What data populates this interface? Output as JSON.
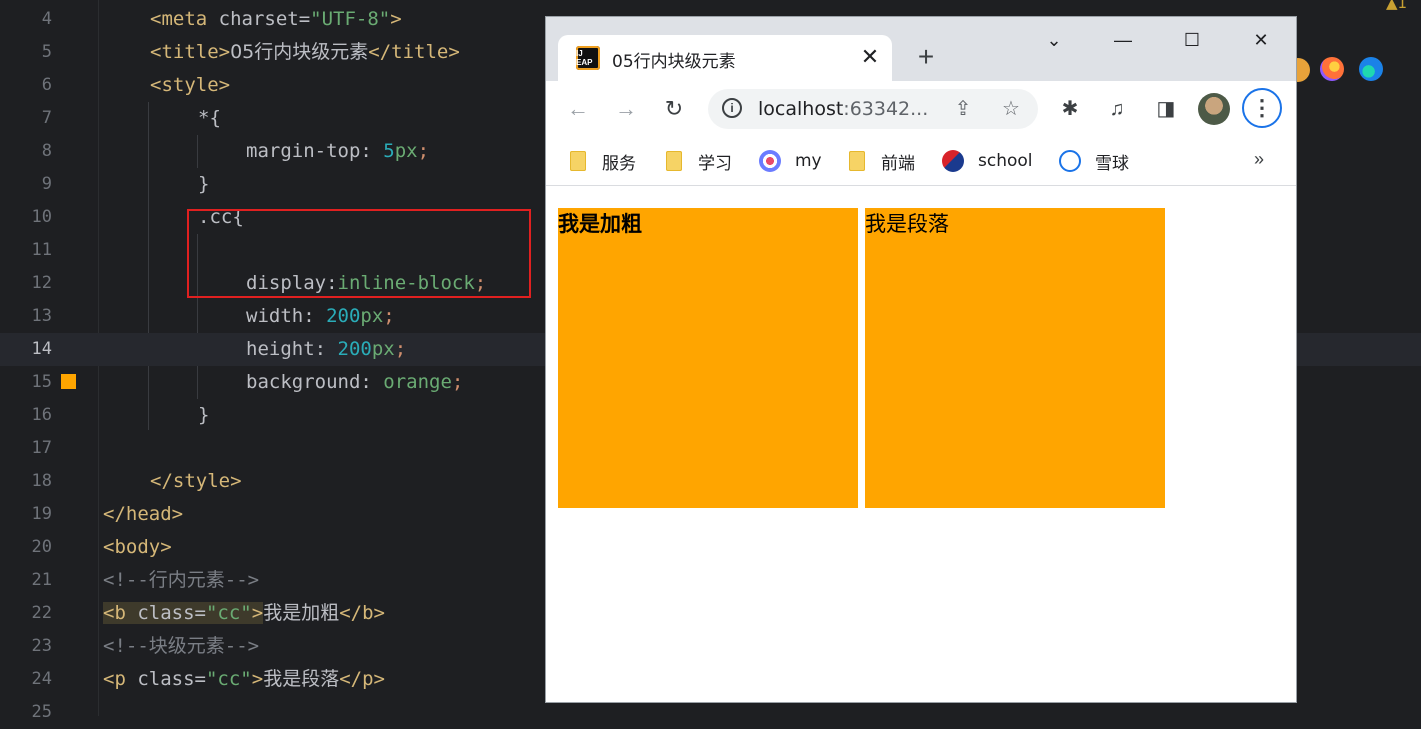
{
  "editor": {
    "lines": [
      {
        "n": "4"
      },
      {
        "n": "5"
      },
      {
        "n": "6"
      },
      {
        "n": "7"
      },
      {
        "n": "8"
      },
      {
        "n": "9"
      },
      {
        "n": "10"
      },
      {
        "n": "11"
      },
      {
        "n": "12"
      },
      {
        "n": "13"
      },
      {
        "n": "14"
      },
      {
        "n": "15"
      },
      {
        "n": "16"
      },
      {
        "n": "17"
      },
      {
        "n": "18"
      },
      {
        "n": "19"
      },
      {
        "n": "20"
      },
      {
        "n": "21"
      },
      {
        "n": "22"
      },
      {
        "n": "23"
      },
      {
        "n": "24"
      },
      {
        "n": "25"
      }
    ],
    "code": {
      "l4_tag_open": "<meta",
      "l4_attr": " charset=",
      "l4_str": "\"UTF-8\"",
      "l4_close": ">",
      "l5_open": "<title>",
      "l5_text_num": "05",
      "l5_text": "行内块级元素",
      "l5_close": "</title>",
      "l6": "<style>",
      "l7": "*{",
      "l8_prop": "margin-top: ",
      "l8_num": "5",
      "l8_unit": "px",
      "l8_semi": ";",
      "l9": "}",
      "l10": ".cc{",
      "l12_prop": "display:",
      "l12_val": "inline-block",
      "l12_semi": ";",
      "l13_prop": "width: ",
      "l13_num": "200",
      "l13_unit": "px",
      "l13_semi": ";",
      "l14_prop": "height: ",
      "l14_num": "200",
      "l14_unit": "px",
      "l14_semi": ";",
      "l15_prop": "background: ",
      "l15_val": "orange",
      "l15_semi": ";",
      "l16": "}",
      "l18": "</style>",
      "l19": "</head>",
      "l20": "<body>",
      "l21_a": "<!--",
      "l21_txt": "行内元素",
      "l21_b": "-->",
      "l22_open": "<b",
      "l22_attr": " class=",
      "l22_str": "\"cc\"",
      "l22_gt": ">",
      "l22_txt": "我是加粗",
      "l22_close": "</b>",
      "l23_a": "<!--",
      "l23_txt": "块级元素",
      "l23_b": "-->",
      "l24_open": "<p",
      "l24_attr": " class=",
      "l24_str": "\"cc\"",
      "l24_gt": ">",
      "l24_txt": "我是段落",
      "l24_close": "</p>"
    },
    "warning_count": "1",
    "current_line": "14"
  },
  "browser": {
    "tab": {
      "title": "05行内块级元素",
      "favicon_text": "IJ EAP"
    },
    "toolbar": {
      "url_host": "localhost",
      "url_port": ":63342...",
      "icons": [
        "back-icon",
        "forward-icon",
        "reload-icon",
        "info-icon",
        "share-icon",
        "star-icon",
        "extensions-icon",
        "media-icon",
        "side-panel-icon",
        "avatar",
        "menu-icon"
      ]
    },
    "bookmarks": [
      {
        "label": "服务",
        "icon": "folder-icon"
      },
      {
        "label": "学习",
        "icon": "folder-icon"
      },
      {
        "label": "my",
        "icon": "site-icon"
      },
      {
        "label": "前端",
        "icon": "folder-icon"
      },
      {
        "label": "school",
        "icon": "site-icon"
      },
      {
        "label": "雪球",
        "icon": "site-icon"
      }
    ],
    "more_label": "»",
    "content": {
      "bold_text": "我是加粗",
      "para_text": "我是段落",
      "box_color": "#ffa500"
    }
  }
}
